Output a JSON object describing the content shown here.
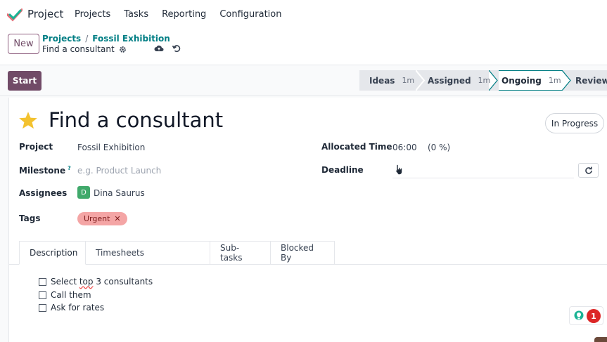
{
  "app": {
    "name": "Project"
  },
  "menu": [
    "Projects",
    "Tasks",
    "Reporting",
    "Configuration"
  ],
  "control": {
    "new_label": "New",
    "breadcrumb": [
      "Projects",
      "Fossil Exhibition"
    ],
    "breadcrumb_sep": "/",
    "current": "Find a consultant"
  },
  "statusbar": {
    "start_label": "Start",
    "stages": [
      {
        "label": "Ideas",
        "duration": "1m"
      },
      {
        "label": "Assigned",
        "duration": "1m"
      },
      {
        "label": "Ongoing",
        "duration": "1m"
      },
      {
        "label": "Review",
        "duration": ""
      }
    ],
    "active_stage": "Ongoing"
  },
  "task": {
    "title": "Find a consultant",
    "state_label": "In Progress",
    "project_label": "Project",
    "project_value": "Fossil Exhibition",
    "milestone_label": "Milestone",
    "milestone_help": "?",
    "milestone_placeholder": "e.g. Product Launch",
    "assignees_label": "Assignees",
    "assignee_initial": "D",
    "assignee_name": "Dina Saurus",
    "tags_label": "Tags",
    "tag": "Urgent",
    "tag_remove": "✕",
    "allocated_label": "Allocated Time",
    "allocated_value": "06:00",
    "allocated_percent": "(0 %)",
    "deadline_label": "Deadline"
  },
  "tabs": [
    "Description",
    "Timesheets",
    "Sub-tasks",
    "Blocked By"
  ],
  "checklist": [
    {
      "pre": "Select ",
      "mark": "top",
      "post": " 3 consultants"
    },
    {
      "pre": "Call them",
      "mark": "",
      "post": ""
    },
    {
      "pre": "Ask for rates",
      "mark": "",
      "post": ""
    }
  ],
  "notification_count": "1",
  "colors": {
    "brand": "#714b67",
    "link": "#017e84",
    "tag_bg": "#f4a5a5",
    "badge": "#dc2626"
  }
}
